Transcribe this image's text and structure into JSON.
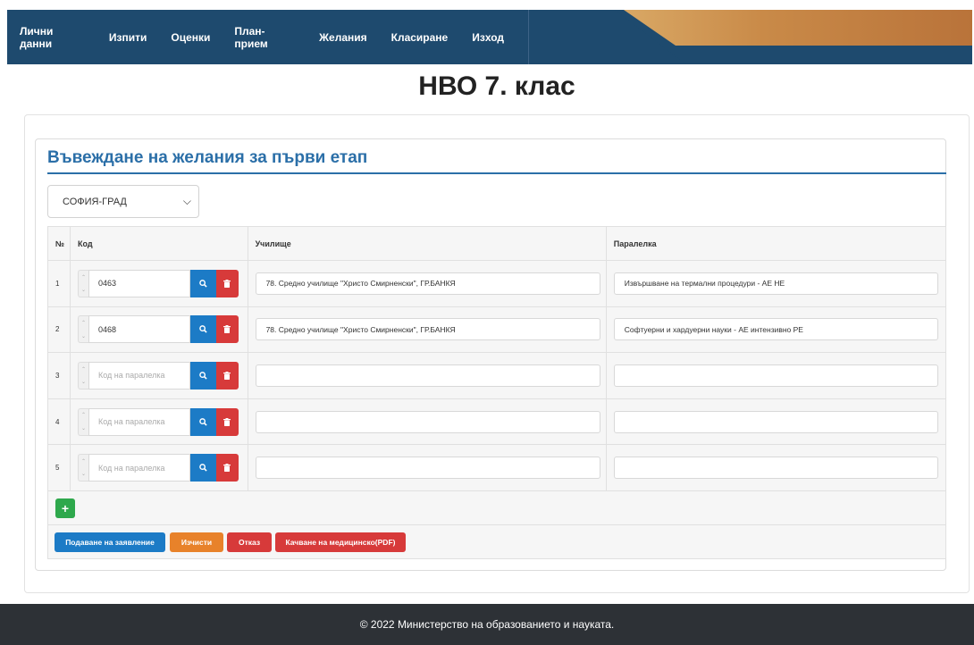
{
  "nav": {
    "items": [
      {
        "label": "Лични данни"
      },
      {
        "label": "Изпити"
      },
      {
        "label": "Оценки"
      },
      {
        "label": "План-прием"
      },
      {
        "label": "Желания"
      },
      {
        "label": "Класиране"
      },
      {
        "label": "Изход"
      }
    ]
  },
  "page": {
    "title": "НВО 7. клас"
  },
  "form": {
    "section_title": "Въвеждане на желания за първи етап",
    "region_selected": "СОФИЯ-ГРАД",
    "table": {
      "headers": {
        "n": "№",
        "code": "Код",
        "school": "Училище",
        "class": "Паралелка"
      },
      "code_placeholder": "Код на паралелка",
      "rows": [
        {
          "n": "1",
          "code": "0463",
          "school": "78. Средно училище \"Христо Смирненски\", ГР.БАНКЯ",
          "class": "Извършване на термални процедури - АЕ НЕ"
        },
        {
          "n": "2",
          "code": "0468",
          "school": "78. Средно училище \"Христо Смирненски\", ГР.БАНКЯ",
          "class": "Софтуерни и хардуерни науки - АЕ интензивно РЕ"
        },
        {
          "n": "3",
          "code": "",
          "school": "",
          "class": ""
        },
        {
          "n": "4",
          "code": "",
          "school": "",
          "class": ""
        },
        {
          "n": "5",
          "code": "",
          "school": "",
          "class": ""
        }
      ]
    },
    "actions": {
      "submit": "Подаване на заявление",
      "clear": "Изчисти",
      "cancel": "Отказ",
      "upload": "Качване на медицинско(PDF)"
    }
  },
  "footer": {
    "text": "© 2022 Министерство на образованието и науката."
  },
  "colors": {
    "nav_bg": "#1e4a6e",
    "accent_blue": "#1c7bc6",
    "danger": "#d73a3a",
    "success": "#2ea84c",
    "warning": "#e8822a"
  }
}
